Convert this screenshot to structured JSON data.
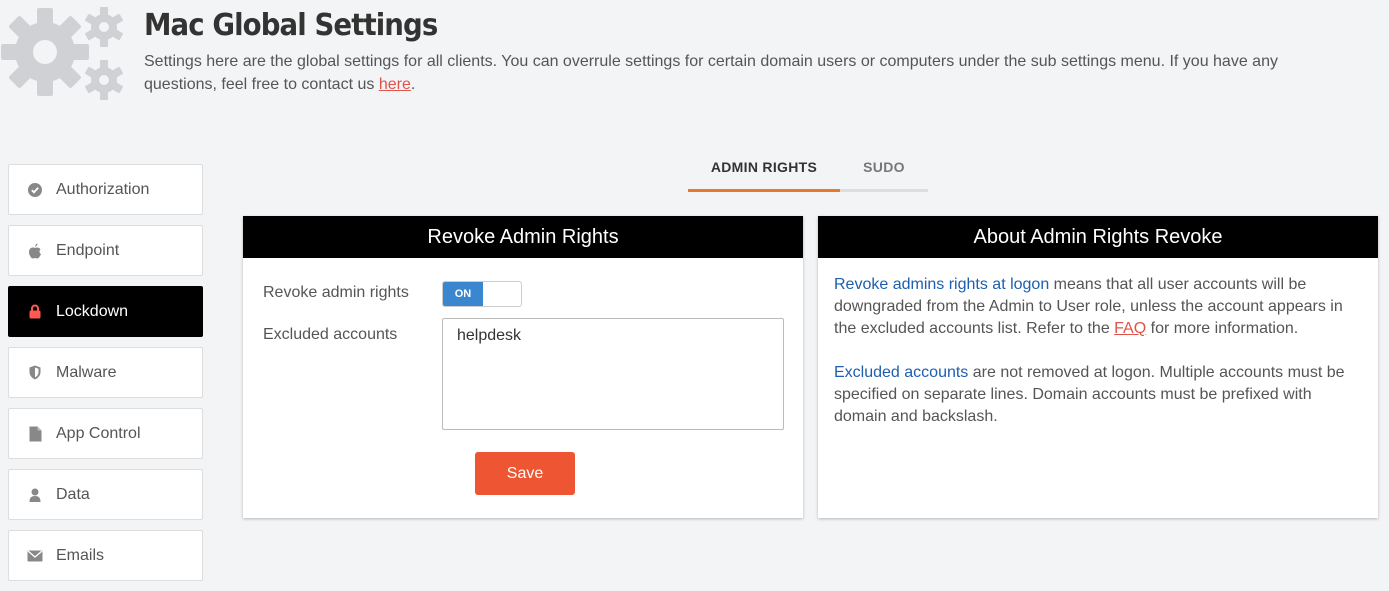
{
  "header": {
    "title": "Mac Global Settings",
    "desc_before": "Settings here are the global settings for all clients. You can overrule settings for certain domain users or computers under the sub settings menu. If you have any questions, feel free to contact us ",
    "desc_link": "here",
    "desc_after": "."
  },
  "sidebar": {
    "items": [
      {
        "label": "Authorization",
        "icon": "check-circle-icon"
      },
      {
        "label": "Endpoint",
        "icon": "apple-icon"
      },
      {
        "label": "Lockdown",
        "icon": "lock-icon",
        "active": true
      },
      {
        "label": "Malware",
        "icon": "shield-icon"
      },
      {
        "label": "App Control",
        "icon": "file-icon"
      },
      {
        "label": "Data",
        "icon": "user-icon"
      },
      {
        "label": "Emails",
        "icon": "envelope-icon"
      }
    ]
  },
  "tabs": [
    {
      "label": "ADMIN RIGHTS",
      "active": true
    },
    {
      "label": "SUDO",
      "active": false
    }
  ],
  "revoke_panel": {
    "title": "Revoke Admin Rights",
    "revoke_label": "Revoke admin rights",
    "toggle_state": "ON",
    "excluded_label": "Excluded accounts",
    "excluded_value": "helpdesk",
    "save_label": "Save"
  },
  "about_panel": {
    "title": "About Admin Rights Revoke",
    "p1_highlight": "Revoke admins rights at logon",
    "p1_text": " means that all user accounts will be downgraded from the Admin to User role, unless the account appears in the excluded accounts list. Refer to the ",
    "p1_link": "FAQ",
    "p1_end": " for more information.",
    "p2_highlight": "Excluded accounts",
    "p2_text": " are not removed at logon. Multiple accounts must be specified on separate lines. Domain accounts must be prefixed with domain and backslash."
  },
  "colors": {
    "accent": "#e8782a",
    "save_button": "#ee5533",
    "toggle_on": "#3a86cf",
    "link": "#e0534a",
    "highlight": "#1d5fae"
  }
}
